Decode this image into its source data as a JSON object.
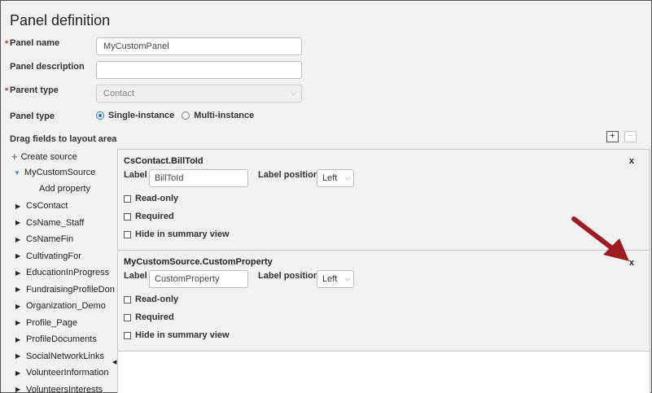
{
  "page": {
    "title": "Panel definition"
  },
  "form": {
    "panel_name_label": "Panel name",
    "panel_name_value": "MyCustomPanel",
    "panel_description_label": "Panel description",
    "panel_description_value": "",
    "parent_type_label": "Parent type",
    "parent_type_value": "Contact",
    "panel_type_label": "Panel type",
    "panel_type_options": [
      "Single-instance",
      "Multi-instance"
    ],
    "panel_type_selected": "Single-instance",
    "required_marker": "*"
  },
  "layout_section": {
    "heading": "Drag fields to layout area",
    "add_button": "+",
    "remove_button": "−"
  },
  "tree": {
    "create_source": "Create source",
    "expanded_source": "MyCustomSource",
    "add_property": "Add property",
    "sources": [
      "CsContact",
      "CsName_Staff",
      "CsNameFin",
      "CultivatingFor",
      "EducationInProgress",
      "FundraisingProfileDonor",
      "Organization_Demo",
      "Profile_Page",
      "ProfileDocuments",
      "SocialNetworkLinks",
      "VolunteerInformation",
      "VolunteersInterests"
    ]
  },
  "cards": [
    {
      "title": "CsContact.BillToId",
      "close": "x",
      "label_label": "Label",
      "label_value": "BillToId",
      "label_position_label": "Label position",
      "label_position_value": "Left",
      "checks": [
        "Read-only",
        "Required",
        "Hide in summary view"
      ]
    },
    {
      "title": "MyCustomSource.CustomProperty",
      "close": "x",
      "label_label": "Label",
      "label_value": "CustomProperty",
      "label_position_label": "Label position",
      "label_position_value": "Left",
      "checks": [
        "Read-only",
        "Required",
        "Hide in summary view"
      ]
    }
  ],
  "colors": {
    "accent": "#1a6fd6",
    "required": "#c0392b",
    "callout_arrow": "#9e1b1f"
  }
}
